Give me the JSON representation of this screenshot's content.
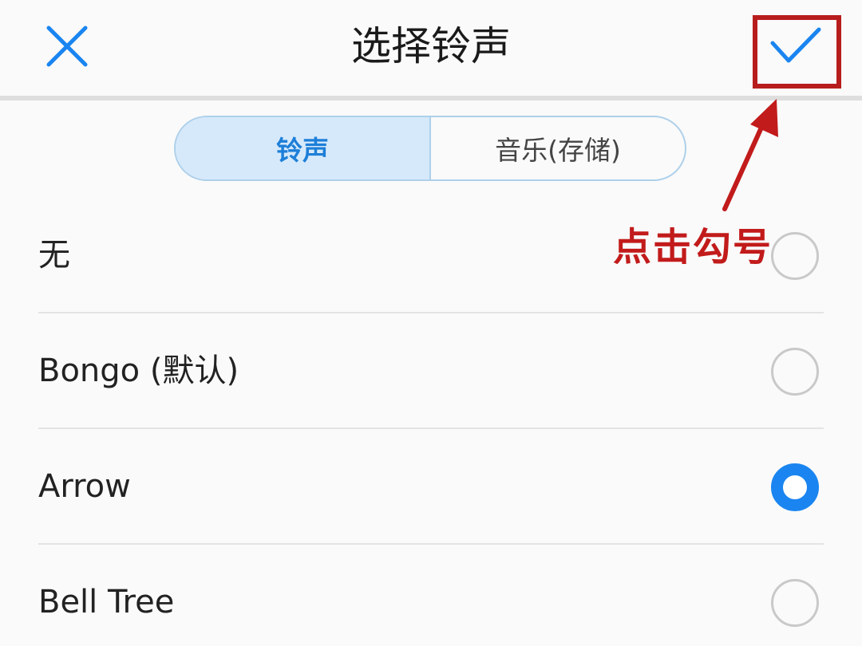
{
  "header": {
    "title": "选择铃声",
    "close_icon": "close-icon",
    "confirm_icon": "checkmark-icon"
  },
  "tabs": [
    {
      "label": "铃声",
      "active": true
    },
    {
      "label": "音乐(存储)",
      "active": false
    }
  ],
  "ringtones": [
    {
      "label": "无",
      "selected": false
    },
    {
      "label": "Bongo (默认)",
      "selected": false
    },
    {
      "label": "Arrow",
      "selected": true
    },
    {
      "label": "Bell Tree",
      "selected": false
    }
  ],
  "annotation": {
    "text": "点击勾号"
  },
  "colors": {
    "accent_blue": "#1a85f0",
    "tab_active_bg": "#d6e9fb",
    "annotation_red": "#c21b1b"
  }
}
